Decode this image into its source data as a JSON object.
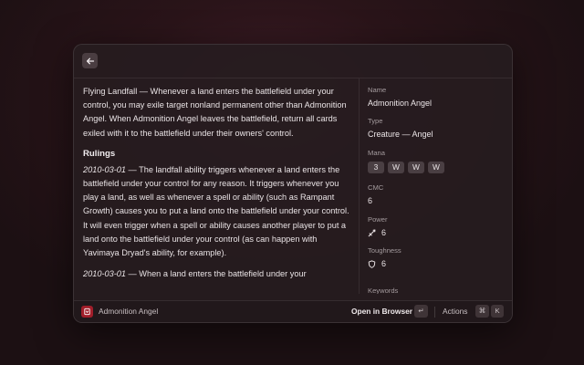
{
  "card": {
    "oracle_text": "Flying Landfall — Whenever a land enters the battlefield under your control, you may exile target nonland permanent other than Admonition Angel. When Admonition Angel leaves the battlefield, return all cards exiled with it to the battlefield under their owners' control.",
    "rulings_heading": "Rulings",
    "rulings": [
      {
        "date": "2010-03-01",
        "text": " — The landfall ability triggers whenever a land enters the battlefield under your control for any reason. It triggers whenever you play a land, as well as whenever a spell or ability (such as Rampant Growth) causes you to put a land onto the battlefield under your control. It will even trigger when a spell or ability causes another player to put a land onto the battlefield under your control (as can happen with Yavimaya Dryad's ability, for example)."
      },
      {
        "date": "2010-03-01",
        "text": " — When a land enters the battlefield under your"
      }
    ]
  },
  "metadata": {
    "name_label": "Name",
    "name_value": "Admonition Angel",
    "type_label": "Type",
    "type_value": "Creature — Angel",
    "mana_label": "Mana",
    "mana_symbols": [
      "3",
      "W",
      "W",
      "W"
    ],
    "cmc_label": "CMC",
    "cmc_value": "6",
    "power_label": "Power",
    "power_icon": "sword-icon",
    "power_value": "6",
    "toughness_label": "Toughness",
    "toughness_icon": "shield-icon",
    "toughness_value": "6",
    "keywords_label": "Keywords"
  },
  "footer": {
    "app_icon": "mtg-app-icon",
    "title": "Admonition Angel",
    "primary_action": "Open in Browser",
    "primary_shortcut": "↵",
    "actions_label": "Actions",
    "actions_shortcut_mod": "⌘",
    "actions_shortcut_key": "K"
  },
  "colors": {
    "accent": "#a11e2a",
    "window_bg": "#261c1f",
    "chip_bg": "#4a3f43"
  }
}
